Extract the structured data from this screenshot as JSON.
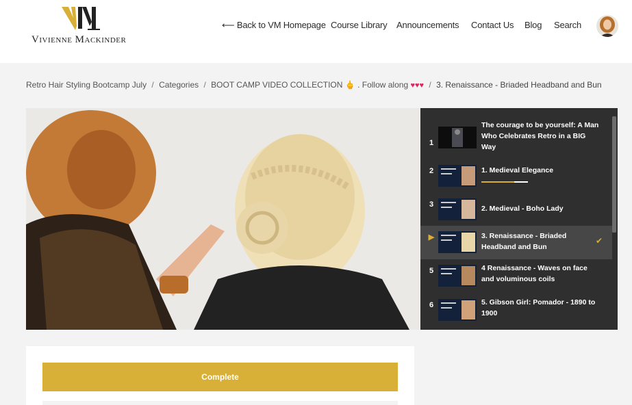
{
  "brand": {
    "logo_text": "Vivienne Mackinder",
    "monogram": "VM",
    "colors": {
      "gold": "#d8af37",
      "dark": "#222222"
    }
  },
  "nav": {
    "back_arrow": "⟵",
    "back_label": "Back to VM Homepage",
    "items": [
      "Course Library",
      "Announcements",
      "Contact Us",
      "Blog",
      "Search"
    ]
  },
  "breadcrumb": {
    "items": [
      "Retro Hair Styling Bootcamp July",
      "Categories",
      "BOOT CAMP VIDEO COLLECTION",
      "3. Renaissance - Briaded Headband and Bun"
    ],
    "emoji_hand": "🖕",
    "follow_along": ". Follow along",
    "hearts": "♥♥♥",
    "separator": "/"
  },
  "playlist": {
    "items": [
      {
        "num": "1",
        "title": "The courage to be yourself: A Man Who Celebrates Retro in a BIG Way"
      },
      {
        "num": "2",
        "title": "1. Medieval Elegance",
        "progress": 0.7
      },
      {
        "num": "3",
        "title": "2. Medieval - Boho Lady"
      },
      {
        "num": "▶",
        "title": "3. Renaissance - Briaded Headband and Bun",
        "active": true,
        "completed": true
      },
      {
        "num": "5",
        "title": "4 Renaissance - Waves on face and voluminous coils"
      },
      {
        "num": "6",
        "title": "5. Gibson Girl: Pomador - 1890 to 1900"
      }
    ]
  },
  "actions": {
    "complete_label": "Complete"
  },
  "icons": {
    "check": "✔"
  }
}
